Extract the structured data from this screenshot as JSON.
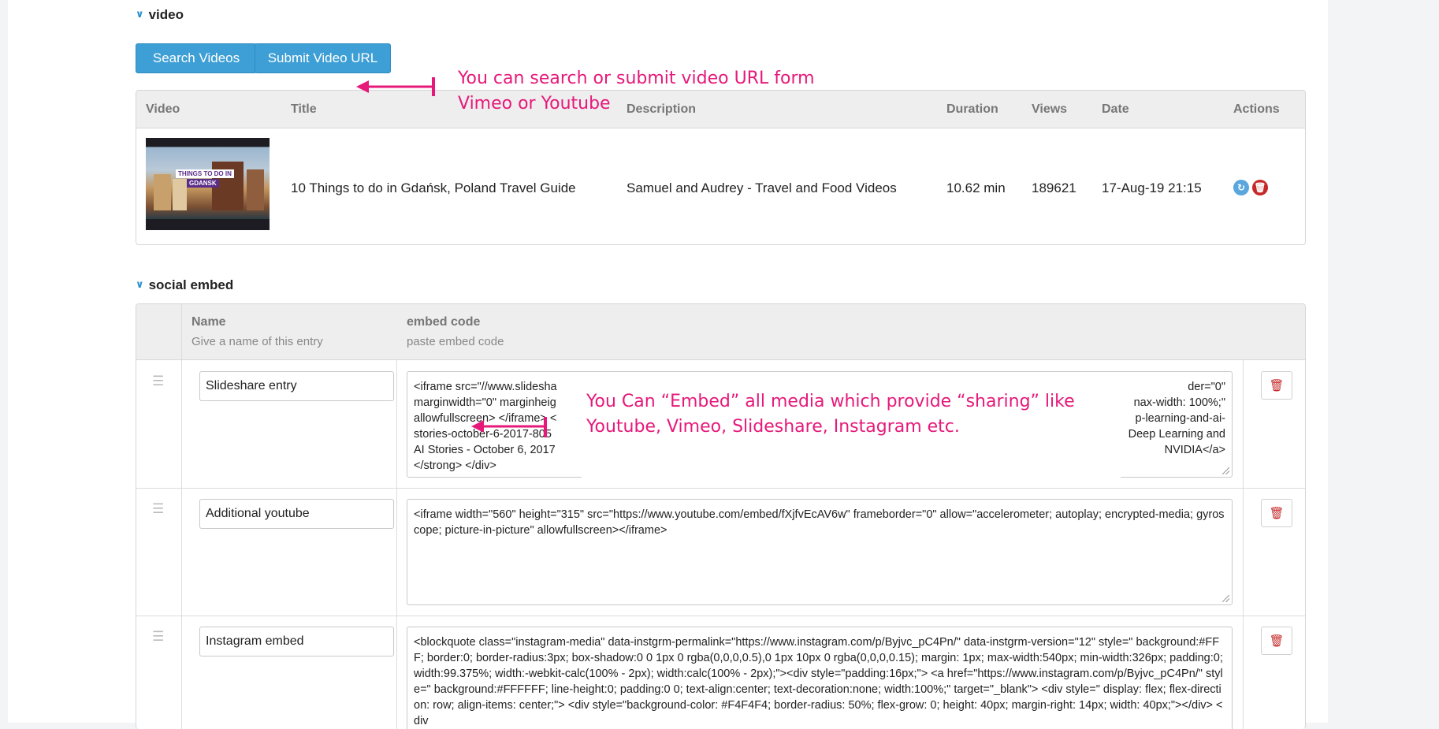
{
  "video_section": {
    "title": "video",
    "search_button": "Search Videos",
    "submit_button": "Submit Video URL",
    "annotation_line1": "You can search or submit video URL form",
    "annotation_line2": "Vimeo or Youtube",
    "columns": {
      "video": "Video",
      "title": "Title",
      "description": "Description",
      "duration": "Duration",
      "views": "Views",
      "date": "Date",
      "actions": "Actions"
    },
    "rows": [
      {
        "thumb_line1": "THINGS TO DO IN",
        "thumb_line2": "GDANSK",
        "title": "10 Things to do in Gdańsk, Poland Travel Guide",
        "description": "Samuel and Audrey - Travel and Food Videos",
        "duration": "10.62 min",
        "views": "189621",
        "date": "17-Aug-19 21:15"
      }
    ]
  },
  "social_section": {
    "title": "social embed",
    "col_name": "Name",
    "col_name_hint": "Give a name of this entry",
    "col_embed": "embed code",
    "col_embed_hint": "paste embed code",
    "annotation_line1": "You Can “Embed” all media which provide “sharing” like",
    "annotation_line2": "Youtube, Vimeo, Slideshare, Instagram etc.",
    "rows": [
      {
        "name": "Slideshare entry",
        "code_left": "<iframe src=\"//www.slidesha\nmarginwidth=\"0\" marginheig\nallowfullscreen> </iframe> <\nstories-october-6-2017-805\nAI Stories - October 6, 2017\n</strong> </div>",
        "code_right": "der=\"0\"\nnax-width: 100%;\"\np-learning-and-ai-\nDeep Learning and\nNVIDIA</a>"
      },
      {
        "name": "Additional youtube",
        "code": "<iframe width=\"560\" height=\"315\" src=\"https://www.youtube.com/embed/fXjfvEcAV6w\" frameborder=\"0\" allow=\"accelerometer; autoplay; encrypted-media; gyroscope; picture-in-picture\" allowfullscreen></iframe>"
      },
      {
        "name": "Instagram embed",
        "code": "<blockquote class=\"instagram-media\" data-instgrm-permalink=\"https://www.instagram.com/p/Byjvc_pC4Pn/\" data-instgrm-version=\"12\" style=\" background:#FFF; border:0; border-radius:3px; box-shadow:0 0 1px 0 rgba(0,0,0,0.5),0 1px 10px 0 rgba(0,0,0,0.15); margin: 1px; max-width:540px; min-width:326px; padding:0; width:99.375%; width:-webkit-calc(100% - 2px); width:calc(100% - 2px);\"><div style=\"padding:16px;\"> <a href=\"https://www.instagram.com/p/Byjvc_pC4Pn/\" style=\" background:#FFFFFF; line-height:0; padding:0 0; text-align:center; text-decoration:none; width:100%;\" target=\"_blank\"> <div style=\" display: flex; flex-direction: row; align-items: center;\"> <div style=\"background-color: #F4F4F4; border-radius: 50%; flex-grow: 0; height: 40px; margin-right: 14px; width: 40px;\"></div> <div"
      }
    ]
  },
  "colors": {
    "accent": "#3d9fd5",
    "annotation": "#e6197a",
    "delete": "#c62828"
  }
}
